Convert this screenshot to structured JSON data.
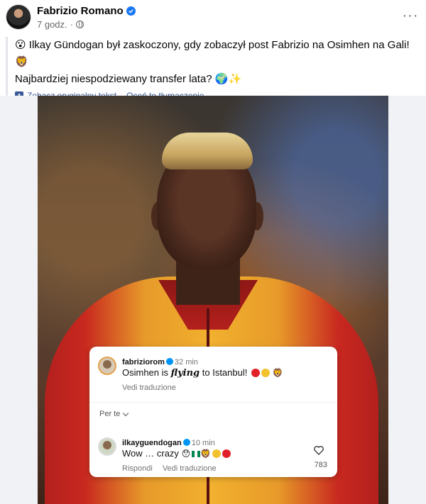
{
  "post": {
    "author": "Fabrizio Romano",
    "time": "7 godz.",
    "line1": "😮 Ilkay Gündogan był zaskoczony, gdy zobaczył post Fabrizio na Osimhen na Gali! 🦁",
    "line2": "Najbardziej niespodziewany transfer lata? 🌍✨",
    "see_original": "Zobacz oryginalny tekst",
    "rate_translation": "Oceń to tłumaczenie",
    "separator": "·"
  },
  "overlay": {
    "comment1": {
      "user": "fabriziorom",
      "time": "32 min",
      "text_prefix": "Osimhen is ",
      "text_emph": "flying",
      "text_suffix": " to Istanbul!",
      "translate": "Vedi traduzione"
    },
    "filter_label": "Per te",
    "comment2": {
      "user": "ilkayguendogan",
      "time": "10 min",
      "text": "Wow … crazy",
      "reply": "Rispondi",
      "translate": "Vedi traduzione",
      "likes": "783"
    }
  },
  "colors": {
    "link": "#385898",
    "verified": "#1877f2",
    "ig_verified": "#0095f6",
    "galatasaray_red": "#c8281f",
    "galatasaray_yellow": "#f1b02e"
  }
}
